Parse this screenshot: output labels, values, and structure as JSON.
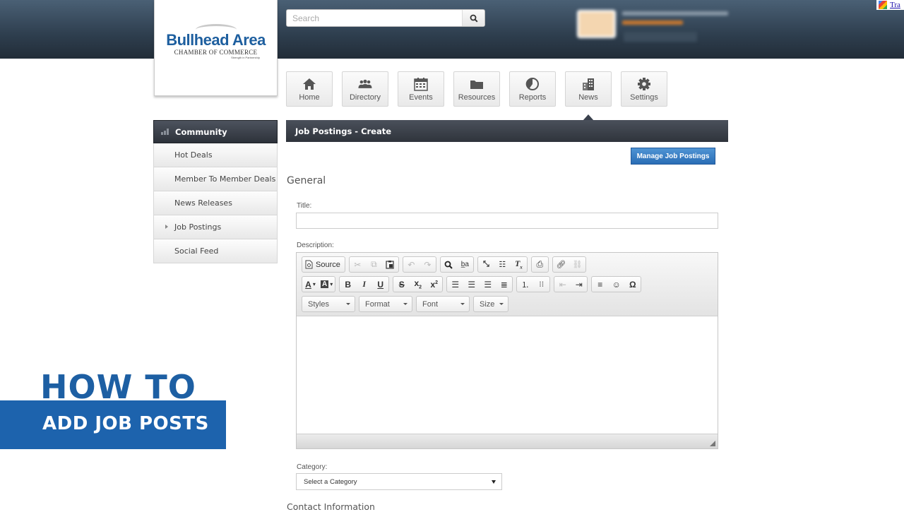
{
  "header": {
    "logo": {
      "name": "Bullhead Area",
      "subtitle": "CHAMBER OF COMMERCE",
      "tagline": "Strength in Partnership"
    },
    "search": {
      "placeholder": "Search",
      "value": ""
    },
    "translate_label": "Tra"
  },
  "nav": {
    "active": "News",
    "items": [
      {
        "label": "Home",
        "icon": "home-icon"
      },
      {
        "label": "Directory",
        "icon": "people-icon"
      },
      {
        "label": "Events",
        "icon": "calendar-icon"
      },
      {
        "label": "Resources",
        "icon": "folder-icon"
      },
      {
        "label": "Reports",
        "icon": "pie-chart-icon"
      },
      {
        "label": "News",
        "icon": "buildings-icon"
      },
      {
        "label": "Settings",
        "icon": "gear-icon"
      }
    ]
  },
  "sidebar": {
    "title": "Community",
    "items": [
      {
        "label": "Hot Deals",
        "active": false
      },
      {
        "label": "Member To Member Deals",
        "active": false
      },
      {
        "label": "News Releases",
        "active": false
      },
      {
        "label": "Job Postings",
        "active": true
      },
      {
        "label": "Social Feed",
        "active": false
      }
    ]
  },
  "main": {
    "title": "Job Postings - Create",
    "manage_button": "Manage Job Postings",
    "section_general": "General",
    "title_label": "Title:",
    "title_value": "",
    "description_label": "Description:",
    "editor": {
      "source_label": "Source",
      "combos": [
        "Styles",
        "Format",
        "Font",
        "Size"
      ],
      "content": ""
    },
    "category_label": "Category:",
    "category_value": "Select a Category",
    "section_contact": "Contact Information"
  },
  "overlay": {
    "line1": "HOW TO",
    "line2": "ADD JOB POSTS"
  },
  "colors": {
    "brand_blue": "#1d63ad",
    "header_dark": "#2e3e4e",
    "button_blue": "#2a6db5"
  }
}
